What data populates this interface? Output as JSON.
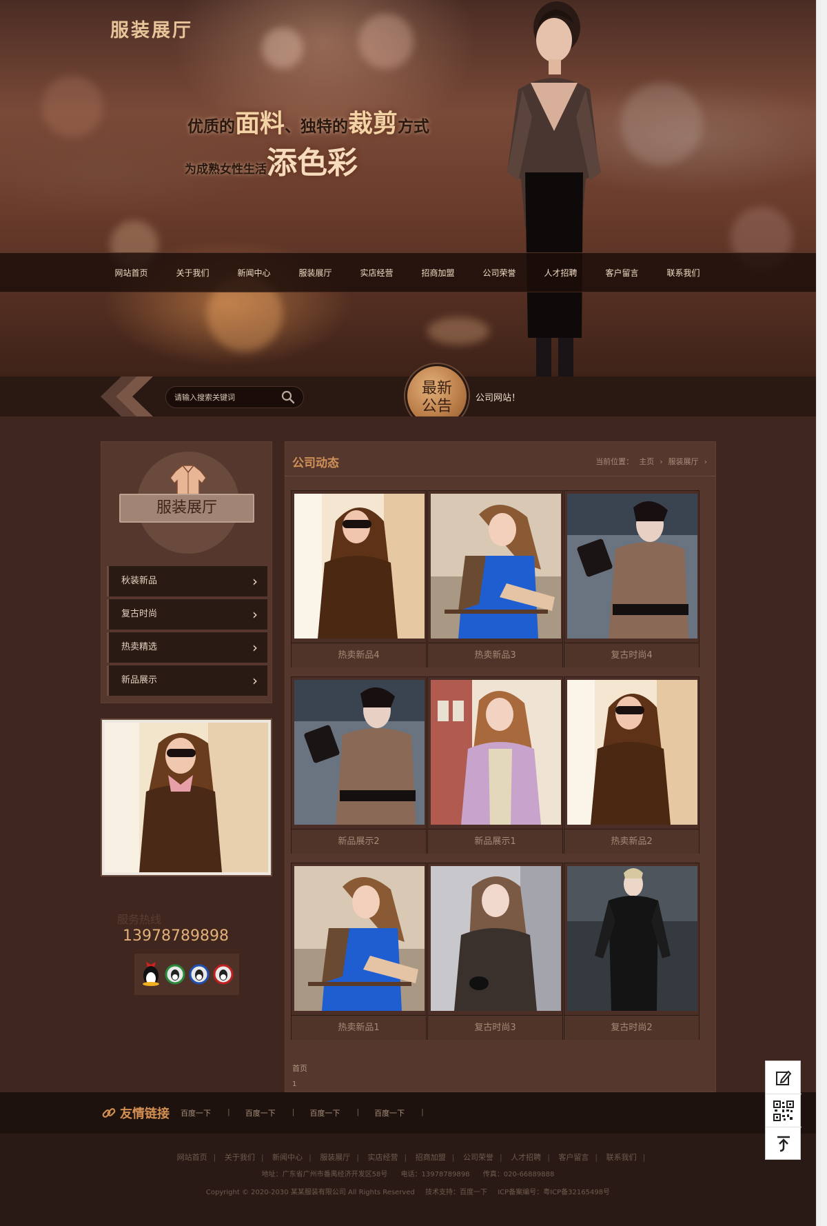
{
  "site": {
    "title": "服装展厅"
  },
  "banner": {
    "slogan_line1_a": "优质的",
    "slogan_line1_b": "面料",
    "slogan_line1_c": "、独特的",
    "slogan_line1_d": "裁剪",
    "slogan_line1_e": "方式",
    "slogan_line2_a": "为成熟女性生活",
    "slogan_line2_b": "添色彩"
  },
  "nav": {
    "items": [
      {
        "label": "网站首页"
      },
      {
        "label": "关于我们"
      },
      {
        "label": "新闻中心"
      },
      {
        "label": "服装展厅"
      },
      {
        "label": "实店经营"
      },
      {
        "label": "招商加盟"
      },
      {
        "label": "公司荣誉"
      },
      {
        "label": "人才招聘"
      },
      {
        "label": "客户留言"
      },
      {
        "label": "联系我们"
      }
    ]
  },
  "search": {
    "placeholder": "请输入搜索关键词"
  },
  "notice": {
    "badge_line1": "最新",
    "badge_line2": "公告",
    "text": "公司网站！"
  },
  "sidebar": {
    "title": "服装展厅",
    "items": [
      {
        "label": "秋装新品"
      },
      {
        "label": "复古时尚"
      },
      {
        "label": "热卖精选"
      },
      {
        "label": "新品展示"
      }
    ],
    "hotline_label": "服务热线",
    "hotline_number": "13978789898"
  },
  "content": {
    "title": "公司动态",
    "breadcrumb": {
      "prefix": "当前位置：",
      "home": "主页",
      "current": "服装展厅"
    },
    "products": [
      {
        "caption": "热卖新品4"
      },
      {
        "caption": "热卖新品3"
      },
      {
        "caption": "复古时尚4"
      },
      {
        "caption": "新品展示2"
      },
      {
        "caption": "新品展示1"
      },
      {
        "caption": "热卖新品2"
      },
      {
        "caption": "热卖新品1"
      },
      {
        "caption": "复古时尚3"
      },
      {
        "caption": "复古时尚2"
      }
    ],
    "pager_first": "首页",
    "pager_num": "1"
  },
  "links": {
    "title": "友情链接",
    "items": [
      {
        "label": "百度一下"
      },
      {
        "label": "百度一下"
      },
      {
        "label": "百度一下"
      },
      {
        "label": "百度一下"
      }
    ]
  },
  "footer": {
    "nav": [
      "网站首页",
      "关于我们",
      "新闻中心",
      "服装展厅",
      "实店经营",
      "招商加盟",
      "公司荣誉",
      "人才招聘",
      "客户留言",
      "联系我们"
    ],
    "address": "地址：广东省广州市番禺经济开发区58号",
    "phone": "电话：13978789898",
    "fax": "传真：020-66889888",
    "copyright": "Copyright © 2020-2030 某某服装有限公司 All Rights Reserved",
    "support": "技术支持：百度一下",
    "icp": "ICP备案编号：粤ICP备32165498号"
  },
  "colors": {
    "accent": "#d09058",
    "nav_bg": "#1c0e0a",
    "page_bg": "#3e2822"
  },
  "icons": {
    "search": "search-icon",
    "chevron": "chevron-right-icon",
    "link": "link-icon",
    "edit": "edit-icon",
    "qrcode": "qrcode-icon",
    "top": "back-to-top-icon"
  }
}
